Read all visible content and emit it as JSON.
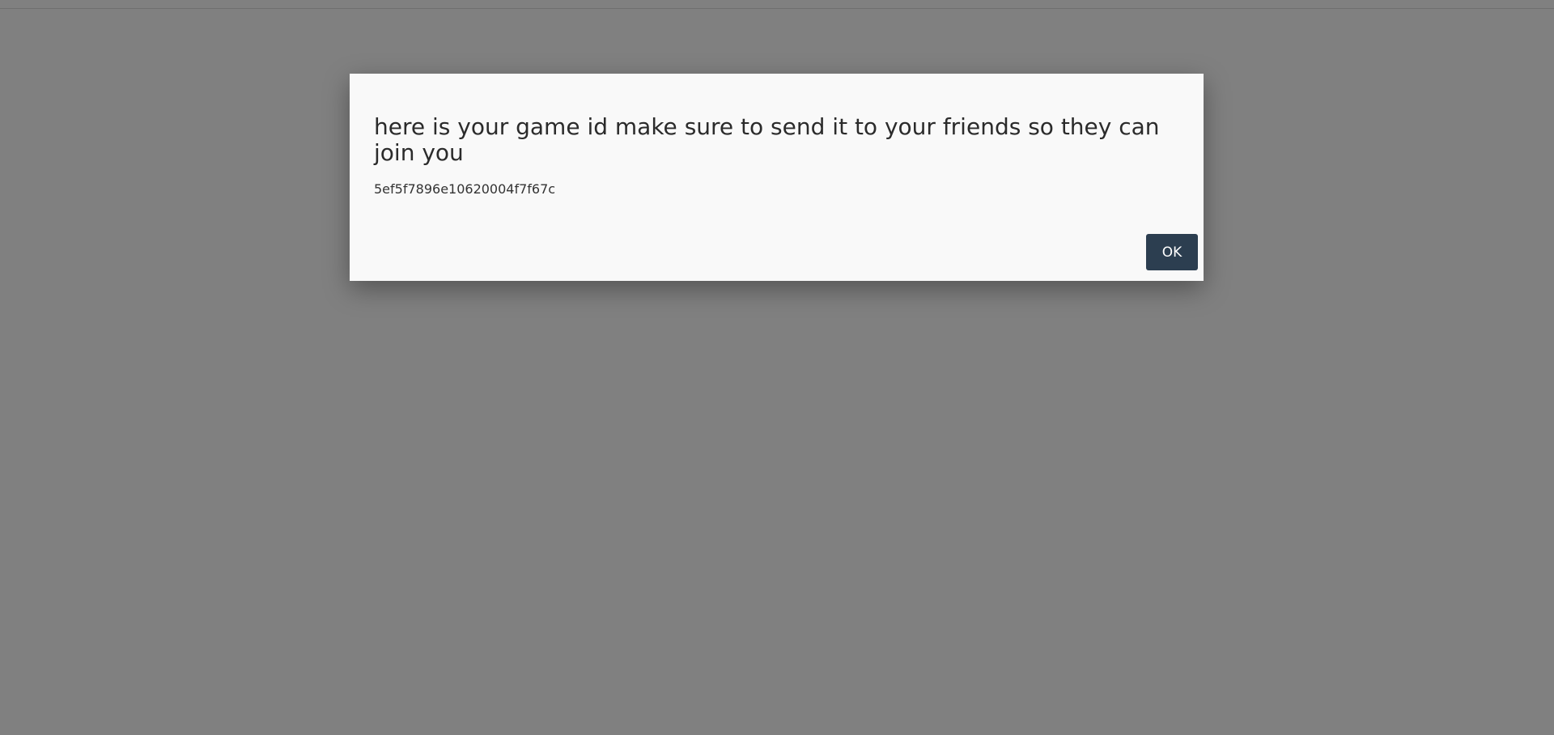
{
  "modal": {
    "title": "here is your game id make sure to send it to your friends so they can join you",
    "game_id": "5ef5f7896e10620004f7f67c",
    "ok_label": "OK"
  },
  "colors": {
    "backdrop": "#808080",
    "modal_background": "#f9f9f9",
    "button_background": "#2c3e50",
    "button_text": "#ffffff"
  }
}
